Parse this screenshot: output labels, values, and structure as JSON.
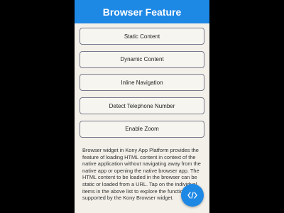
{
  "header": {
    "title": "Browser Feature"
  },
  "menu": {
    "items": [
      {
        "label": "Static Content"
      },
      {
        "label": "Dynamic Content"
      },
      {
        "label": "Inline Navigation"
      },
      {
        "label": "Detect Telephone Number"
      },
      {
        "label": "Enable Zoom"
      }
    ]
  },
  "description": "Browser widget in Kony App Platform provides the feature of loading HTML content in context of the native application without navigating away from the native app or opening the native browser app. The HTML content to be loaded in the browser can be static or loaded from a URL. Tap on the individual items in the above list to explore the functionalities supported by the Kony Browser widget.",
  "fab": {
    "icon": "code-icon"
  },
  "colors": {
    "header_bg": "#1e88e5",
    "content_bg": "#f2f0e9",
    "fab_bg": "#1e88e5"
  }
}
